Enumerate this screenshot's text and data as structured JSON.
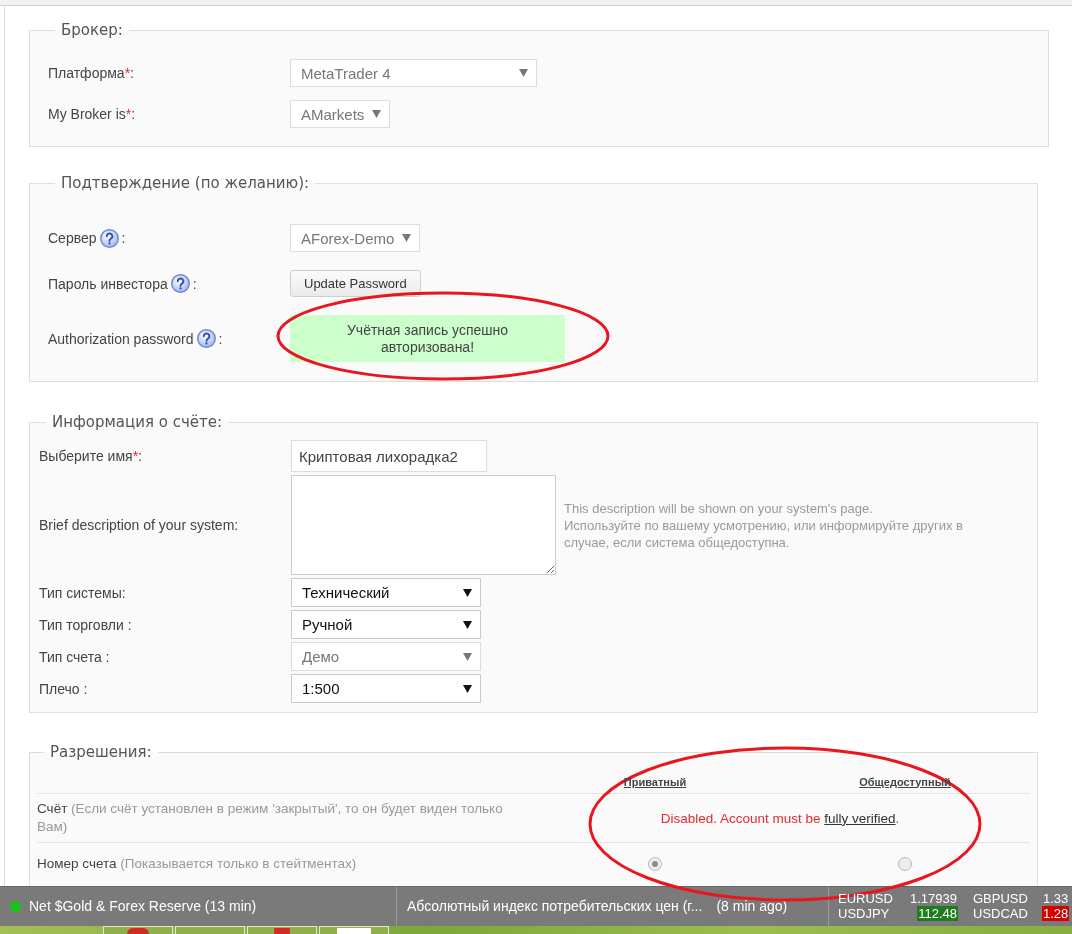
{
  "sections": [
    {
      "kind": "form",
      "legend": "Брокер:",
      "rows": [
        {
          "label": "Платформа",
          "required_mark": "*",
          "suffix": ":",
          "control": {
            "kind": "select",
            "value": "MetaTrader 4",
            "disabled": true
          }
        },
        {
          "label": "My Broker is",
          "required_mark": "*",
          "suffix": ":",
          "control": {
            "kind": "select",
            "value": "AMarkets",
            "disabled": true
          }
        }
      ]
    },
    {
      "kind": "form",
      "legend": "Подтверждение (по желанию):",
      "rows": [
        {
          "label": "Сервер",
          "help": true,
          "suffix": ":",
          "control": {
            "kind": "select",
            "value": "AForex-Demo",
            "disabled": true
          }
        },
        {
          "label": "Пароль инвестора",
          "help": true,
          "suffix": ":",
          "control": {
            "kind": "button",
            "text": "Update Password"
          }
        },
        {
          "label": "Authorization password",
          "help": true,
          "suffix": ":",
          "circled": true,
          "control": {
            "kind": "status",
            "text": "Учётная запись успешно авторизована!"
          }
        }
      ]
    },
    {
      "kind": "dense-form",
      "legend": "Информация о счёте:",
      "rows": [
        {
          "label": "Выберите имя",
          "required_mark": "*",
          "suffix": ":",
          "control": {
            "kind": "input",
            "value": "Криптовая лихорадка2"
          }
        },
        {
          "label": "Brief description of your system:",
          "control": {
            "kind": "textarea",
            "hint": [
              "This description will be shown on your system's page.",
              "Используйте по вашему усмотрению, или информируйте других в случае, если система общедоступна."
            ]
          }
        },
        {
          "label": "Тип системы:",
          "control": {
            "kind": "select",
            "value": "Технический",
            "disabled": false
          }
        },
        {
          "label": "Тип торговли :",
          "control": {
            "kind": "select",
            "value": "Ручной",
            "disabled": false
          }
        },
        {
          "label": "Тип счета :",
          "control": {
            "kind": "select",
            "value": "Демо",
            "disabled": true
          }
        },
        {
          "label": "Плечо :",
          "control": {
            "kind": "select",
            "value": "1:500",
            "disabled": false
          }
        }
      ]
    },
    {
      "kind": "permissions",
      "legend": "Разрешения:",
      "circled": true,
      "columns": [
        "Приватный",
        "Общедоступный"
      ],
      "rows": [
        {
          "kind": "message",
          "name": "Счёт",
          "note": "(Если счёт установлен в режим 'закрытый', то он будет виден только Вам)",
          "message": "Disabled. Account must be",
          "link": "fully verified",
          "end": "."
        },
        {
          "kind": "choice",
          "name": "Номер счета",
          "note": "(Показывается только в стейтментах)",
          "disabled": true,
          "options": [
            {
              "selected": true
            },
            {
              "selected": false
            }
          ]
        }
      ]
    }
  ],
  "ticker": {
    "news": [
      {
        "live": true,
        "title": "Net $Gold & Forex Reserve (13 min)"
      },
      {
        "live": false,
        "title": "Абсолютный индекс потребительских цен (г...",
        "time": "(8 min ago)"
      }
    ],
    "quotes": [
      {
        "kind": "plain",
        "symbol": "EURUSD",
        "price": "1.17939"
      },
      {
        "kind": "plain",
        "symbol": "GBPUSD",
        "price": "1.33"
      },
      {
        "kind": "up",
        "symbol": "USDJPY",
        "price": "112.48"
      },
      {
        "kind": "down",
        "symbol": "USDCAD",
        "price": "1.28"
      }
    ]
  }
}
